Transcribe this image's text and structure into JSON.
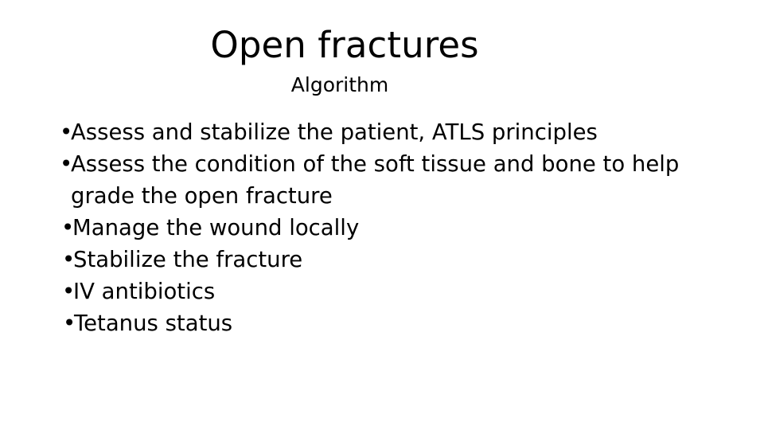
{
  "slide": {
    "title": "Open fractures",
    "subtitle": "Algorithm",
    "background_color": "#ffffff",
    "text_color": "#000000",
    "bullet_glyph": "•",
    "bullets": [
      {
        "text": "Assess and stabilize the patient, ATLS principles"
      },
      {
        "text": "Assess the condition of the soft tissue and bone to help grade the open fracture"
      },
      {
        "text": "Manage the wound locally"
      },
      {
        "text": "Stabilize the fracture"
      },
      {
        "text": "IV antibiotics"
      },
      {
        "text": "Tetanus status"
      }
    ]
  }
}
